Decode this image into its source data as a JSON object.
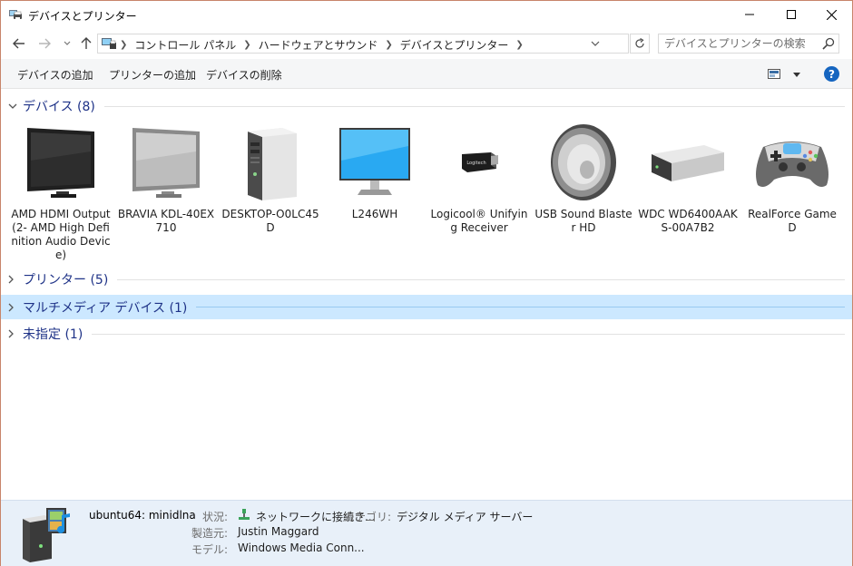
{
  "window": {
    "title": "デバイスとプリンター",
    "minimize_icon": "minimize-icon",
    "maximize_icon": "maximize-icon",
    "close_icon": "close-icon"
  },
  "navigation": {
    "breadcrumbs": [
      "コントロール パネル",
      "ハードウェアとサウンド",
      "デバイスとプリンター"
    ],
    "search_placeholder": "デバイスとプリンターの検索"
  },
  "commands": {
    "add_device": "デバイスの追加",
    "add_printer": "プリンターの追加",
    "remove_device": "デバイスの削除",
    "help": "?"
  },
  "groups": {
    "devices": "デバイス (8)",
    "printers": "プリンター (5)",
    "multimedia": "マルチメディア デバイス (1)",
    "unspecified": "未指定 (1)"
  },
  "devices": [
    {
      "name": "AMD HDMI Output (2- AMD High Definition Audio Device)",
      "icon": "monitor-black-icon"
    },
    {
      "name": "BRAVIA KDL-40EX710",
      "icon": "monitor-gray-icon"
    },
    {
      "name": "DESKTOP-O0LC45D",
      "icon": "tower-pc-icon"
    },
    {
      "name": "L246WH",
      "icon": "monitor-blue-icon"
    },
    {
      "name": "Logicool® Unifying Receiver",
      "icon": "usb-receiver-icon"
    },
    {
      "name": "USB Sound Blaster HD",
      "icon": "speaker-icon"
    },
    {
      "name": "WDC WD6400AAKS-00A7B2",
      "icon": "hard-drive-icon"
    },
    {
      "name": "RealForce Game D",
      "icon": "gamepad-icon"
    }
  ],
  "details": {
    "device_name": "ubuntu64: minidlna",
    "status_label": "状況:",
    "status_value": "ネットワークに接続さ...",
    "category_label": "カテゴリ:",
    "category_value": "デジタル メディア サーバー",
    "manufacturer_label": "製造元:",
    "manufacturer_value": "Justin Maggard",
    "model_label": "モデル:",
    "model_value": "Windows Media Conn..."
  },
  "colors": {
    "accent": "#1e3287",
    "selected_group": "#cce8ff",
    "details_background": "#e8f0f9",
    "help": "#1565c0"
  }
}
